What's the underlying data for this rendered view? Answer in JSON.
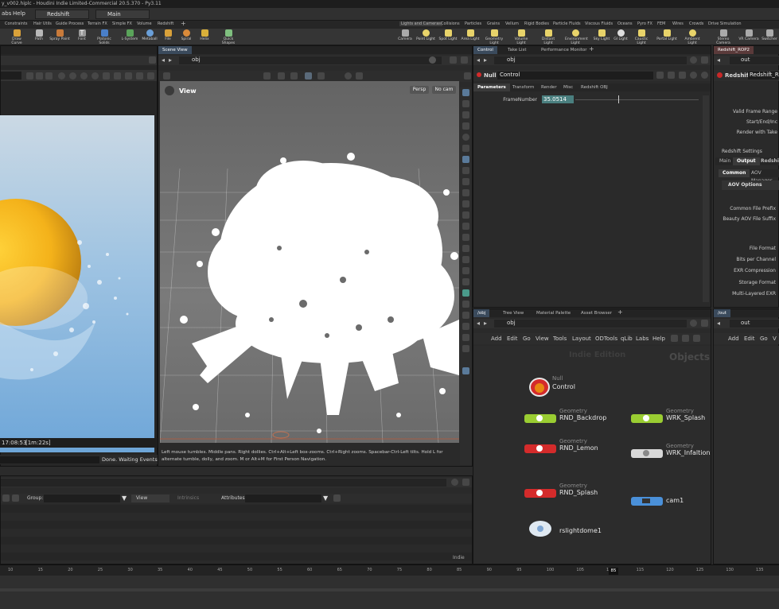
{
  "window": {
    "title": "y_v002.hiplc - Houdini Indie Limited-Commercial 20.5.370 - Py3.11"
  },
  "menubar": {
    "items": [
      "abs",
      "Help"
    ],
    "desktop_dropdown": "Redshift",
    "context_dropdown": "Main"
  },
  "shelf_tabs_left": [
    "Constraints",
    "Hair Utils",
    "Guide Process",
    "Terrain FX",
    "Simple FX",
    "Volume",
    "Redshift"
  ],
  "shelf_tabs_right": [
    "Lights and Cameras",
    "Collisions",
    "Particles",
    "Grains",
    "Vellum",
    "Rigid Bodies",
    "Particle Fluids",
    "Viscous Fluids",
    "Oceans",
    "Pyro FX",
    "FEM",
    "Wires",
    "Crowds",
    "Drive Simulation"
  ],
  "shelf_tools_left": [
    "Draw Curve",
    "Path",
    "Spray Paint",
    "Font",
    "Platonic Solids",
    "L-System",
    "Metaball",
    "File",
    "Spiral",
    "Helix",
    "Quick Shapes"
  ],
  "shelf_tools_right": [
    "Camera",
    "Point Light",
    "Spot Light",
    "Area Light",
    "Geometry Light",
    "Volume Light",
    "Distant Light",
    "Environment Light",
    "Sky Light",
    "GI Light",
    "Caustic Light",
    "Portal Light",
    "Ambient Light",
    "Stereo Camera",
    "VR Camera",
    "Switcher"
  ],
  "render_view": {
    "status_time": "17:08:53",
    "status_elapsed": "[1m:22s]",
    "status_text": "Done. Waiting Events"
  },
  "scene_view": {
    "tab_label": "Scene View",
    "path": "obj",
    "view_label": "View",
    "persp_label": "Persp",
    "cam_label": "No cam",
    "hint_text": "Left mouse tumbles. Middle pans. Right dollies. Ctrl+Alt+Left box-zooms. Ctrl+Right zooms. Spacebar-Ctrl-Left tilts. Hold L for alternate tumble, dolly, and zoom. M or Alt+M for First Person Navigation."
  },
  "parameter_pane": {
    "tabs": [
      "Control",
      "Take List",
      "Performance Monitor"
    ],
    "path": "obj",
    "node_type": "Null",
    "node_name": "Control",
    "parm_tabs": [
      "Parameters",
      "Transform",
      "Render",
      "Misc",
      "Redshift OBJ"
    ],
    "frame_label": "FrameNumber",
    "frame_value": "35.0514",
    "frame_fraction": 0.35
  },
  "rop_pane": {
    "tab": "Redshift_ROP2",
    "path": "out",
    "node_type": "Redshift",
    "node_name": "Redshift_R",
    "labels": [
      "Valid Frame Range",
      "Start/End/Inc",
      "Render with Take"
    ],
    "settings_label": "Redshift Settings",
    "tabs": [
      "Main",
      "Output",
      "Redshift"
    ],
    "subtabs": [
      "Common",
      "AOV Manager"
    ],
    "aov_section": "AOV Options",
    "fields": [
      "Common File Prefix",
      "Beauty AOV File Suffix",
      "File Format",
      "Bits per Channel",
      "EXR Compression",
      "Storage Format",
      "Multi-Layered EXR"
    ]
  },
  "network_pane": {
    "tabs": [
      "/obj",
      "Tree View",
      "Material Palette",
      "Asset Browser"
    ],
    "path": "obj",
    "menu": [
      "Add",
      "Edit",
      "Go",
      "View",
      "Tools",
      "Layout",
      "ODTools",
      "qLib",
      "Labs",
      "Help"
    ],
    "watermark": "Indie Edition",
    "context_label": "Objects",
    "nodes": [
      {
        "type": "Null",
        "name": "Control",
        "color": "#d42b2b"
      },
      {
        "type": "Geometry",
        "name": "RND_Backdrop",
        "color": "#9acd32"
      },
      {
        "type": "Geometry",
        "name": "WRK_Splash",
        "color": "#9acd32"
      },
      {
        "type": "Geometry",
        "name": "RND_Lemon",
        "color": "#d42b2b"
      },
      {
        "type": "Geometry",
        "name": "WRK_InfaltionS",
        "color": "#d8d8d8"
      },
      {
        "type": "Geometry",
        "name": "RND_Splash",
        "color": "#d42b2b"
      },
      {
        "type": "",
        "name": "cam1",
        "color": "#4a90d9"
      },
      {
        "type": "",
        "name": "rslightdome1",
        "color": "#d8d8d8"
      }
    ]
  },
  "out_pane": {
    "tab": "/out",
    "path": "out",
    "menu": [
      "Add",
      "Edit",
      "Go",
      "V"
    ]
  },
  "spreadsheet": {
    "group_label": "Group:",
    "view_label": "View",
    "intrinsics_label": "Intrinsics",
    "attributes_label": "Attributes:",
    "indie_label": "Indie"
  },
  "timeline": {
    "ticks": [
      "10",
      "15",
      "20",
      "25",
      "30",
      "35",
      "40",
      "45",
      "50",
      "55",
      "60",
      "65",
      "70",
      "75",
      "80",
      "85",
      "90",
      "95",
      "100",
      "105",
      "110",
      "115",
      "120",
      "125",
      "130",
      "135"
    ],
    "current_frame": "85"
  }
}
